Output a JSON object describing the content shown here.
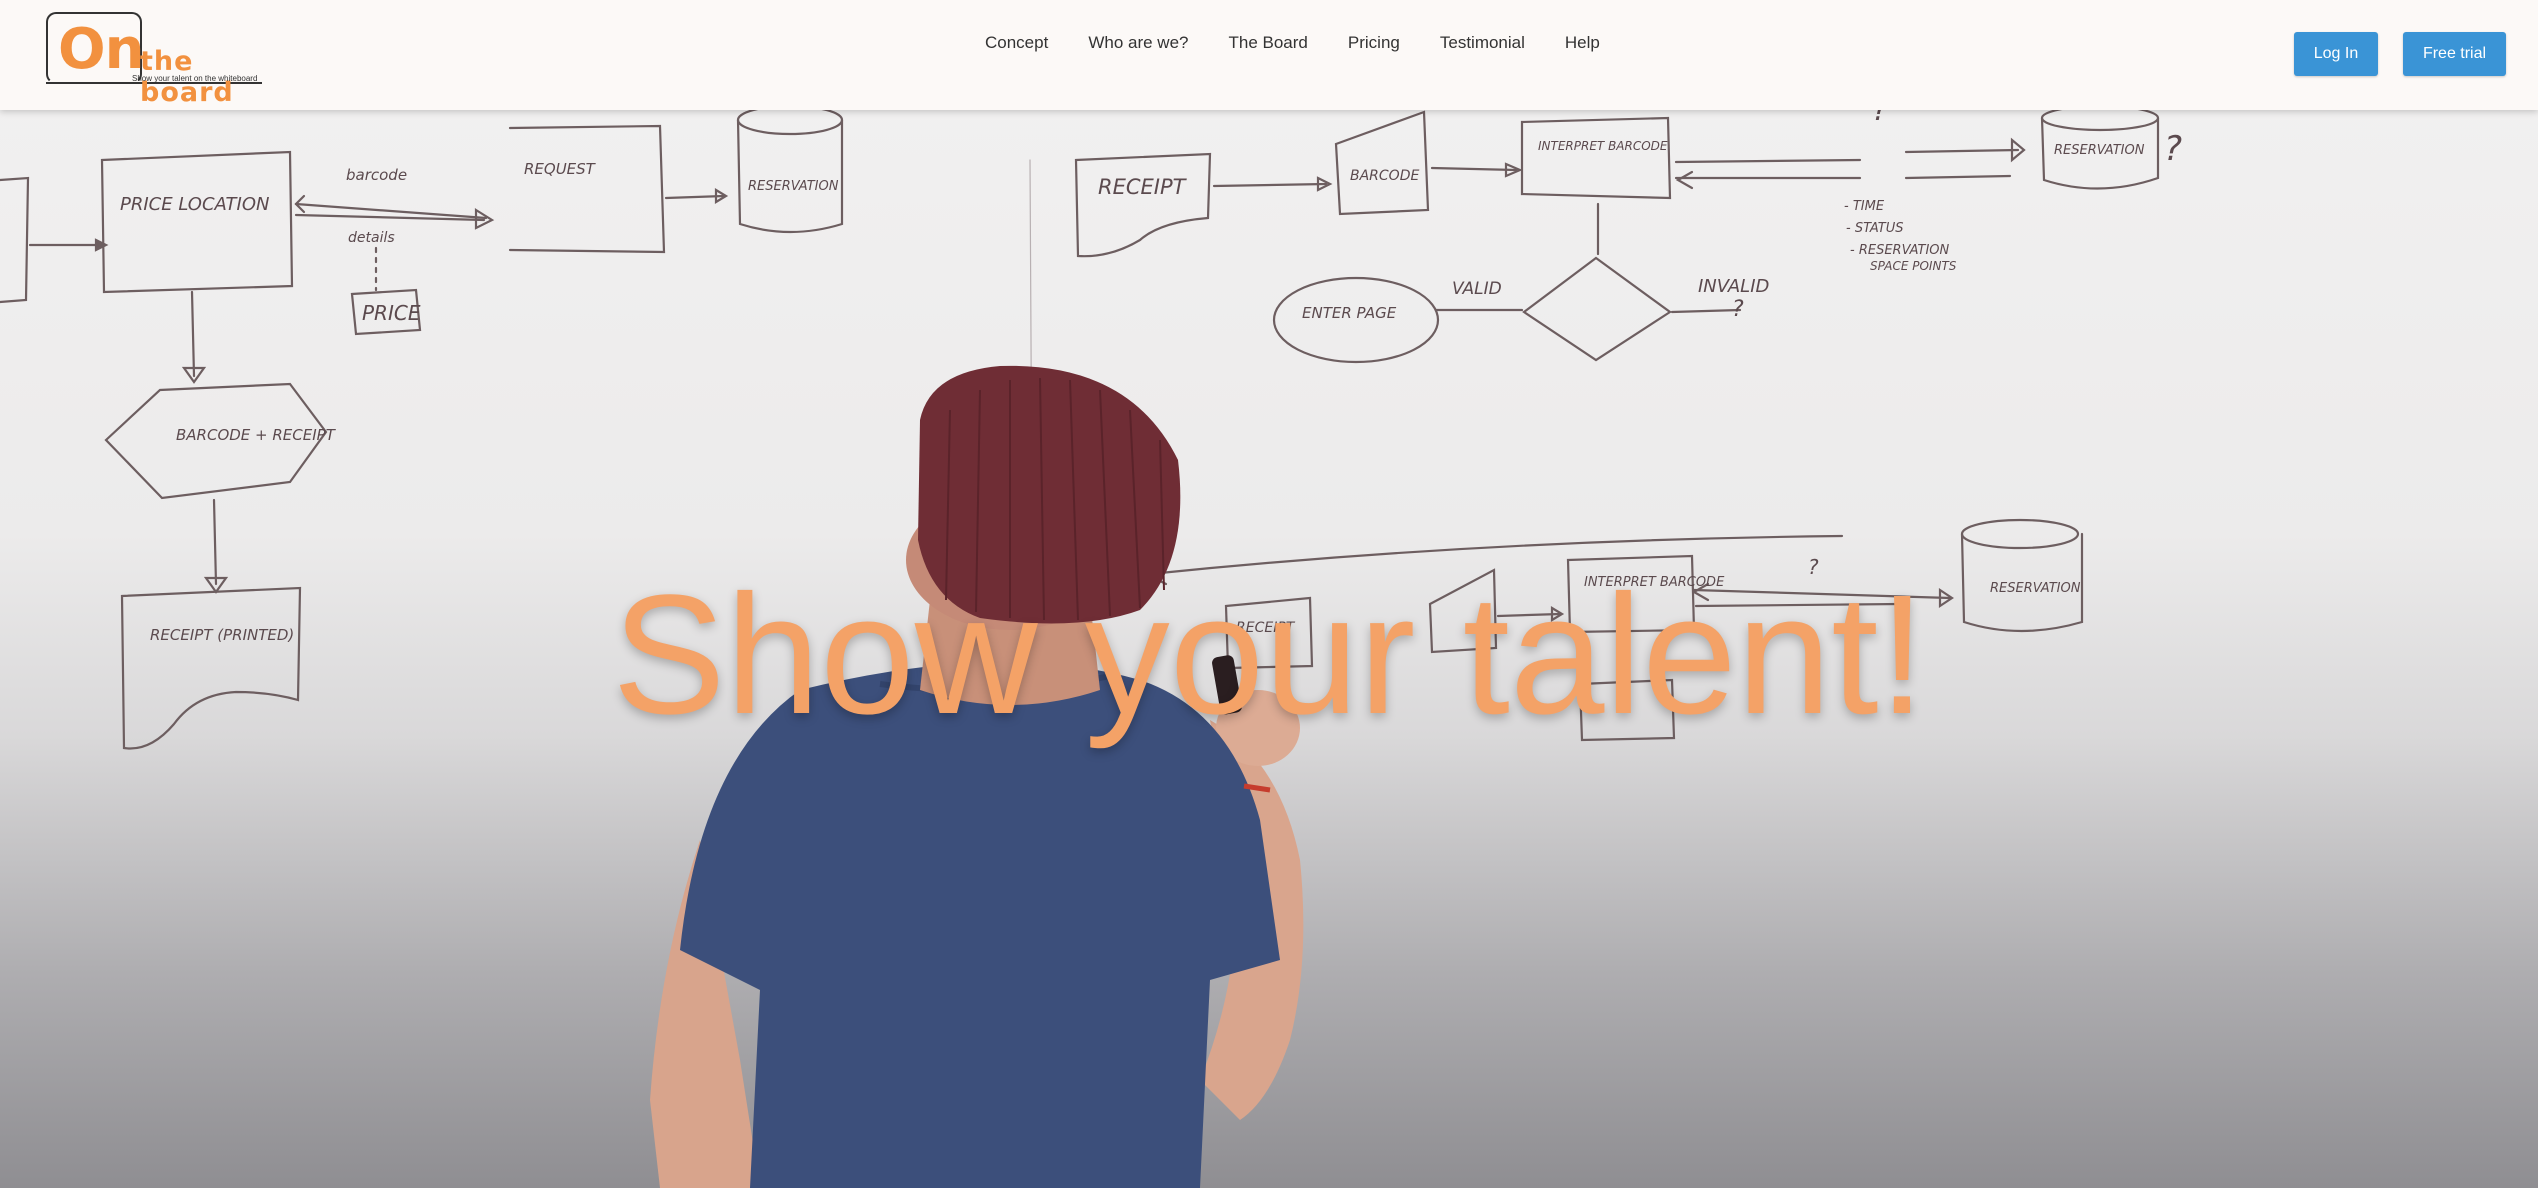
{
  "brand": {
    "logo_on": "On",
    "logo_board": "the board",
    "tagline": "Show your talent on the whiteboard",
    "accent_color": "#f2913f"
  },
  "nav": {
    "items": [
      {
        "label": "Concept"
      },
      {
        "label": "Who are we?"
      },
      {
        "label": "The Board"
      },
      {
        "label": "Pricing"
      },
      {
        "label": "Testimonial"
      },
      {
        "label": "Help"
      }
    ]
  },
  "actions": {
    "login_label": "Log In",
    "trial_label": "Free trial",
    "button_color": "#3a94d6"
  },
  "hero": {
    "title": "Show your talent!",
    "title_color": "#f4a267",
    "image_description_icon": "whiteboard-photo"
  },
  "whiteboard_text": {
    "price_location": "PRICE LOCATION",
    "barcode_top": "barcode",
    "details": "details",
    "price": "PRICE",
    "request": "REQUEST",
    "reservation_1": "RESERVATION",
    "receipt": "RECEIPT",
    "barcode_mid": "BARCODE",
    "interpret_barcode": "INTERPRET BARCODE",
    "reservation_2": "RESERVATION",
    "enter_page": "ENTER PAGE",
    "valid": "VALID",
    "invalid": "INVALID",
    "barcode_receipt": "BARCODE + RECEIPT",
    "receipt_printed": "RECEIPT (PRINTED)",
    "notes_1": "- TIME",
    "notes_2": "- STATUS",
    "notes_3": "- RESERVATION",
    "notes_4": "SPACE POINTS",
    "interpret_barcode_2": "INTERPRET BARCODE",
    "reservation_3": "RESERVATION",
    "receipt_2": "RECEIPT"
  }
}
